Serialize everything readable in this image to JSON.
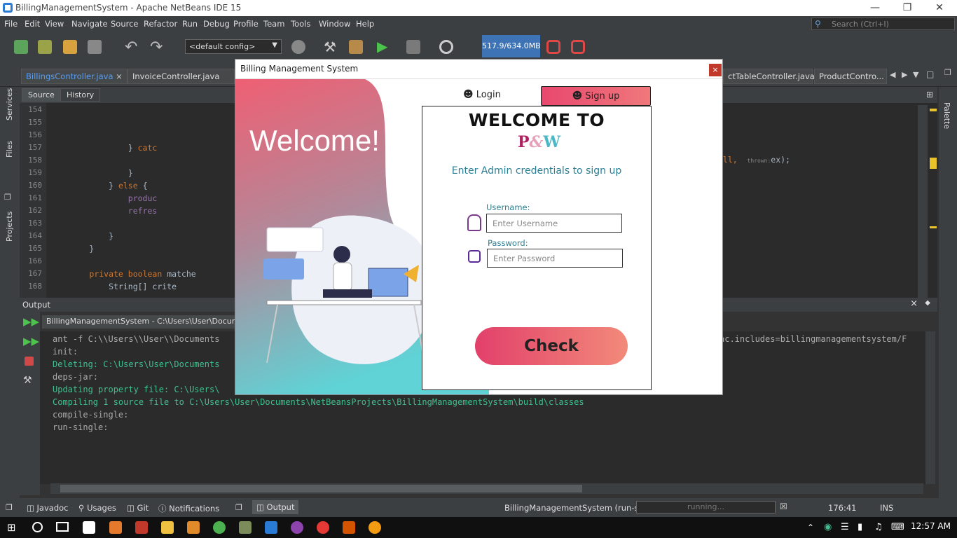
{
  "window": {
    "title": "BillingManagementSystem - Apache NetBeans IDE 15"
  },
  "menu": [
    "File",
    "Edit",
    "View",
    "Navigate",
    "Source",
    "Refactor",
    "Run",
    "Debug",
    "Profile",
    "Team",
    "Tools",
    "Window",
    "Help"
  ],
  "search_placeholder": "Search (Ctrl+I)",
  "toolbar": {
    "config": "<default config>",
    "memory": "517.9/634.0MB"
  },
  "tabs": [
    "BillingsController.java",
    "InvoiceController.java",
    "ctTableController.java",
    "ProductContro..."
  ],
  "editor": {
    "source_label": "Source",
    "history_label": "History"
  },
  "code_lines": [
    {
      "n": "154",
      "t": ""
    },
    {
      "n": "155",
      "t": ""
    },
    {
      "n": "156",
      "t": ""
    },
    {
      "n": "157",
      "t": "                } catc"
    },
    {
      "n": "158",
      "t": ""
    },
    {
      "n": "159",
      "t": "                }"
    },
    {
      "n": "160",
      "t": "            } else {"
    },
    {
      "n": "161",
      "t": "                produc"
    },
    {
      "n": "162",
      "t": "                refres"
    },
    {
      "n": "163",
      "t": ""
    },
    {
      "n": "164",
      "t": "            }"
    },
    {
      "n": "165",
      "t": "        }"
    },
    {
      "n": "166",
      "t": ""
    },
    {
      "n": "167",
      "t": "        private boolean matche"
    },
    {
      "n": "168",
      "t": "            String[] crite"
    }
  ],
  "code_right": {
    "t1": "ull,",
    "hint": "thrown:",
    "t2": "ex);"
  },
  "side_labels": {
    "services": "Services",
    "files": "Files",
    "projects": "Projects",
    "palette": "Palette"
  },
  "output": {
    "header": "Output",
    "tab": "BillingManagementSystem - C:\\Users\\User\\Documents\\N",
    "lines": [
      {
        "t": "ant -f C:\\\\Users\\\\User\\\\Documents",
        "c": ""
      },
      {
        "t": "init:",
        "c": ""
      },
      {
        "t": "Deleting: C:\\Users\\User\\Documents",
        "c": "g"
      },
      {
        "t": "deps-jar:",
        "c": ""
      },
      {
        "t": "Updating property file: C:\\Users\\",
        "c": "g"
      },
      {
        "t": "Compiling 1 source file to C:\\Users\\User\\Documents\\NetBeansProjects\\BillingManagementSystem\\build\\classes",
        "c": "g"
      },
      {
        "t": "compile-single:",
        "c": ""
      },
      {
        "t": "run-single:",
        "c": ""
      }
    ],
    "right_text": "ac.includes=billingmanagementsystem/F"
  },
  "status": {
    "javadoc": "Javadoc",
    "usages": "Usages",
    "git": "Git",
    "notifications": "Notifications",
    "output": "Output",
    "task": "BillingManagementSystem (run-single)",
    "progress": "running...",
    "position": "176:41",
    "mode": "INS"
  },
  "clock": "12:57 AM",
  "dialog": {
    "title": "Billing Management System",
    "close": "×",
    "welcome": "Welcome!",
    "login_tab": "Login",
    "signup_tab": "Sign up",
    "heading": "WELCOME TO",
    "logo_p": "P",
    "logo_amp": "&",
    "logo_w": "W",
    "subtitle": "Enter Admin credentials to sign up",
    "username_label": "Username:",
    "username_placeholder": "Enter Username",
    "password_label": "Password:",
    "password_placeholder": "Enter Password",
    "check": "Check"
  }
}
